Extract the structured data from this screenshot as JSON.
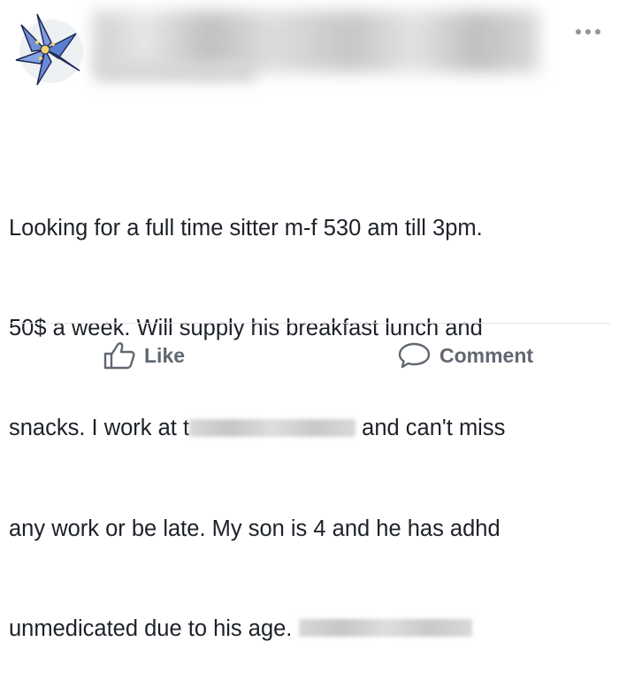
{
  "post": {
    "author_name": "",
    "lines": [
      {
        "a": "Looking for a full time sitter m-f 530 am till 3pm."
      },
      {
        "a": "50$ a week. Will supply his breakfast lunch and"
      },
      {
        "a": "snacks. I work at t",
        "b": "and can't miss"
      },
      {
        "a": "any work or be late. My son is 4 and he has adhd"
      },
      {
        "a": "unmedicated due to his age."
      }
    ]
  },
  "actions": {
    "like_label": "Like",
    "comment_label": "Comment"
  },
  "icons": {
    "avatar": "blue-flower-avatar",
    "more": "more-options-icon",
    "like": "thumbs-up-icon",
    "comment": "speech-bubble-icon"
  },
  "colors": {
    "text": "#1d2129",
    "action_text": "#606770",
    "avatar_flower": "#6f8fd6"
  }
}
